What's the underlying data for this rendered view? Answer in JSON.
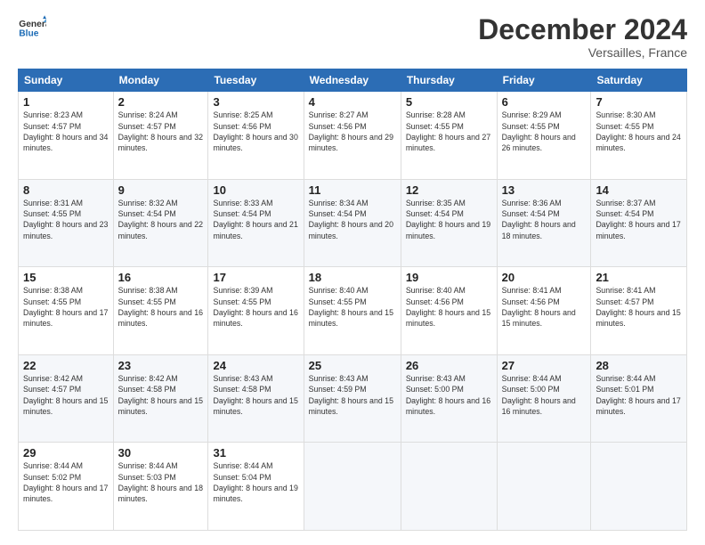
{
  "logo": {
    "line1": "General",
    "line2": "Blue"
  },
  "title": "December 2024",
  "subtitle": "Versailles, France",
  "weekdays": [
    "Sunday",
    "Monday",
    "Tuesday",
    "Wednesday",
    "Thursday",
    "Friday",
    "Saturday"
  ],
  "weeks": [
    [
      {
        "day": "1",
        "sunrise": "8:23 AM",
        "sunset": "4:57 PM",
        "daylight": "8 hours and 34 minutes."
      },
      {
        "day": "2",
        "sunrise": "8:24 AM",
        "sunset": "4:57 PM",
        "daylight": "8 hours and 32 minutes."
      },
      {
        "day": "3",
        "sunrise": "8:25 AM",
        "sunset": "4:56 PM",
        "daylight": "8 hours and 30 minutes."
      },
      {
        "day": "4",
        "sunrise": "8:27 AM",
        "sunset": "4:56 PM",
        "daylight": "8 hours and 29 minutes."
      },
      {
        "day": "5",
        "sunrise": "8:28 AM",
        "sunset": "4:55 PM",
        "daylight": "8 hours and 27 minutes."
      },
      {
        "day": "6",
        "sunrise": "8:29 AM",
        "sunset": "4:55 PM",
        "daylight": "8 hours and 26 minutes."
      },
      {
        "day": "7",
        "sunrise": "8:30 AM",
        "sunset": "4:55 PM",
        "daylight": "8 hours and 24 minutes."
      }
    ],
    [
      {
        "day": "8",
        "sunrise": "8:31 AM",
        "sunset": "4:55 PM",
        "daylight": "8 hours and 23 minutes."
      },
      {
        "day": "9",
        "sunrise": "8:32 AM",
        "sunset": "4:54 PM",
        "daylight": "8 hours and 22 minutes."
      },
      {
        "day": "10",
        "sunrise": "8:33 AM",
        "sunset": "4:54 PM",
        "daylight": "8 hours and 21 minutes."
      },
      {
        "day": "11",
        "sunrise": "8:34 AM",
        "sunset": "4:54 PM",
        "daylight": "8 hours and 20 minutes."
      },
      {
        "day": "12",
        "sunrise": "8:35 AM",
        "sunset": "4:54 PM",
        "daylight": "8 hours and 19 minutes."
      },
      {
        "day": "13",
        "sunrise": "8:36 AM",
        "sunset": "4:54 PM",
        "daylight": "8 hours and 18 minutes."
      },
      {
        "day": "14",
        "sunrise": "8:37 AM",
        "sunset": "4:54 PM",
        "daylight": "8 hours and 17 minutes."
      }
    ],
    [
      {
        "day": "15",
        "sunrise": "8:38 AM",
        "sunset": "4:55 PM",
        "daylight": "8 hours and 17 minutes."
      },
      {
        "day": "16",
        "sunrise": "8:38 AM",
        "sunset": "4:55 PM",
        "daylight": "8 hours and 16 minutes."
      },
      {
        "day": "17",
        "sunrise": "8:39 AM",
        "sunset": "4:55 PM",
        "daylight": "8 hours and 16 minutes."
      },
      {
        "day": "18",
        "sunrise": "8:40 AM",
        "sunset": "4:55 PM",
        "daylight": "8 hours and 15 minutes."
      },
      {
        "day": "19",
        "sunrise": "8:40 AM",
        "sunset": "4:56 PM",
        "daylight": "8 hours and 15 minutes."
      },
      {
        "day": "20",
        "sunrise": "8:41 AM",
        "sunset": "4:56 PM",
        "daylight": "8 hours and 15 minutes."
      },
      {
        "day": "21",
        "sunrise": "8:41 AM",
        "sunset": "4:57 PM",
        "daylight": "8 hours and 15 minutes."
      }
    ],
    [
      {
        "day": "22",
        "sunrise": "8:42 AM",
        "sunset": "4:57 PM",
        "daylight": "8 hours and 15 minutes."
      },
      {
        "day": "23",
        "sunrise": "8:42 AM",
        "sunset": "4:58 PM",
        "daylight": "8 hours and 15 minutes."
      },
      {
        "day": "24",
        "sunrise": "8:43 AM",
        "sunset": "4:58 PM",
        "daylight": "8 hours and 15 minutes."
      },
      {
        "day": "25",
        "sunrise": "8:43 AM",
        "sunset": "4:59 PM",
        "daylight": "8 hours and 15 minutes."
      },
      {
        "day": "26",
        "sunrise": "8:43 AM",
        "sunset": "5:00 PM",
        "daylight": "8 hours and 16 minutes."
      },
      {
        "day": "27",
        "sunrise": "8:44 AM",
        "sunset": "5:00 PM",
        "daylight": "8 hours and 16 minutes."
      },
      {
        "day": "28",
        "sunrise": "8:44 AM",
        "sunset": "5:01 PM",
        "daylight": "8 hours and 17 minutes."
      }
    ],
    [
      {
        "day": "29",
        "sunrise": "8:44 AM",
        "sunset": "5:02 PM",
        "daylight": "8 hours and 17 minutes."
      },
      {
        "day": "30",
        "sunrise": "8:44 AM",
        "sunset": "5:03 PM",
        "daylight": "8 hours and 18 minutes."
      },
      {
        "day": "31",
        "sunrise": "8:44 AM",
        "sunset": "5:04 PM",
        "daylight": "8 hours and 19 minutes."
      },
      null,
      null,
      null,
      null
    ]
  ],
  "labels": {
    "sunrise": "Sunrise:",
    "sunset": "Sunset:",
    "daylight": "Daylight:"
  }
}
